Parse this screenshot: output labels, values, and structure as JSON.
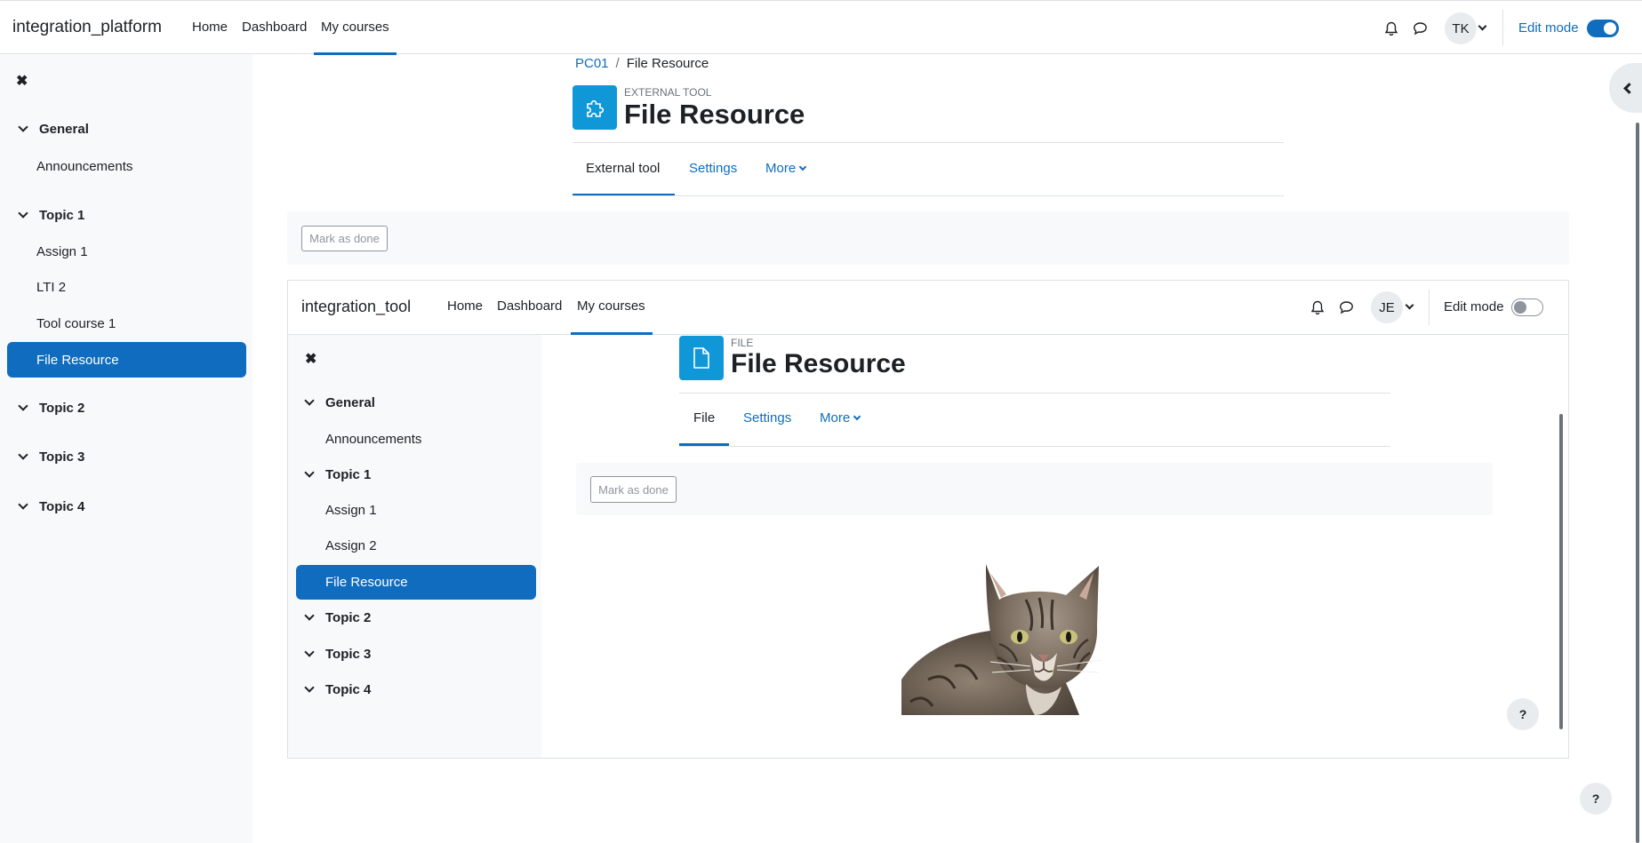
{
  "outer": {
    "brand": "integration_platform",
    "nav": [
      "Home",
      "Dashboard",
      "My courses"
    ],
    "avatar": "TK",
    "edit_mode_label": "Edit mode",
    "edit_mode_on": true,
    "drawer": {
      "sections": [
        {
          "label": "General",
          "items": [
            "Announcements"
          ]
        },
        {
          "label": "Topic 1",
          "items": [
            "Assign 1",
            "LTI 2",
            "Tool course 1",
            "File Resource"
          ]
        },
        {
          "label": "Topic 2",
          "items": []
        },
        {
          "label": "Topic 3",
          "items": []
        },
        {
          "label": "Topic 4",
          "items": []
        }
      ],
      "active_item": "File Resource"
    },
    "breadcrumb": {
      "course": "PC01",
      "current": "File Resource"
    },
    "activity": {
      "kicker": "External tool",
      "title": "File Resource"
    },
    "tabs": [
      "External tool",
      "Settings",
      "More"
    ],
    "mark_done": "Mark as done",
    "help": "?"
  },
  "inner": {
    "brand": "integration_tool",
    "nav": [
      "Home",
      "Dashboard",
      "My courses"
    ],
    "avatar": "JE",
    "edit_mode_label": "Edit mode",
    "edit_mode_on": false,
    "drawer": {
      "sections": [
        {
          "label": "General",
          "items": [
            "Announcements"
          ]
        },
        {
          "label": "Topic 1",
          "items": [
            "Assign 1",
            "Assign 2",
            "File Resource"
          ]
        },
        {
          "label": "Topic 2",
          "items": []
        },
        {
          "label": "Topic 3",
          "items": []
        },
        {
          "label": "Topic 4",
          "items": []
        }
      ],
      "active_item": "File Resource"
    },
    "activity": {
      "kicker": "File",
      "title": "File Resource"
    },
    "tabs": [
      "File",
      "Settings",
      "More"
    ],
    "mark_done": "Mark as done",
    "help": "?"
  },
  "colors": {
    "accent": "#0f6cbf",
    "activity_icon": "#0f97d8",
    "drawer_bg": "#f8f9fa"
  }
}
